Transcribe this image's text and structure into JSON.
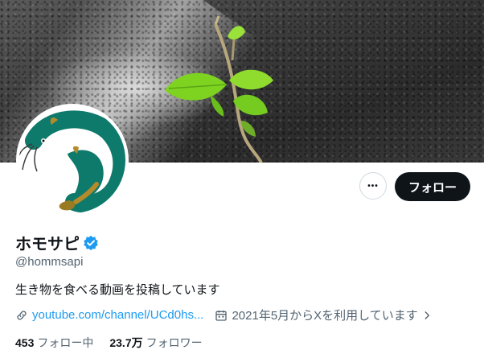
{
  "profile": {
    "display_name": "ホモサピ",
    "handle": "@hommsapi",
    "bio": "生き物を食べる動画を投稿しています",
    "link": "youtube.com/channel/UCd0hs...",
    "joined": "2021年5月からXを利用しています"
  },
  "actions": {
    "more_label": "•••",
    "follow_label": "フォロー"
  },
  "stats": {
    "following_count": "453",
    "following_label": "フォロー中",
    "followers_count": "23.7万",
    "followers_label": "フォロワー"
  },
  "icons": {
    "verified": "verified-badge-icon",
    "link": "link-icon",
    "calendar": "calendar-icon",
    "chevron": "chevron-right-icon",
    "more": "more-icon"
  },
  "colors": {
    "accent": "#1d9bf0",
    "text": "#0f1419",
    "secondary": "#536471",
    "avatar_fish": "#0e7a6b"
  }
}
